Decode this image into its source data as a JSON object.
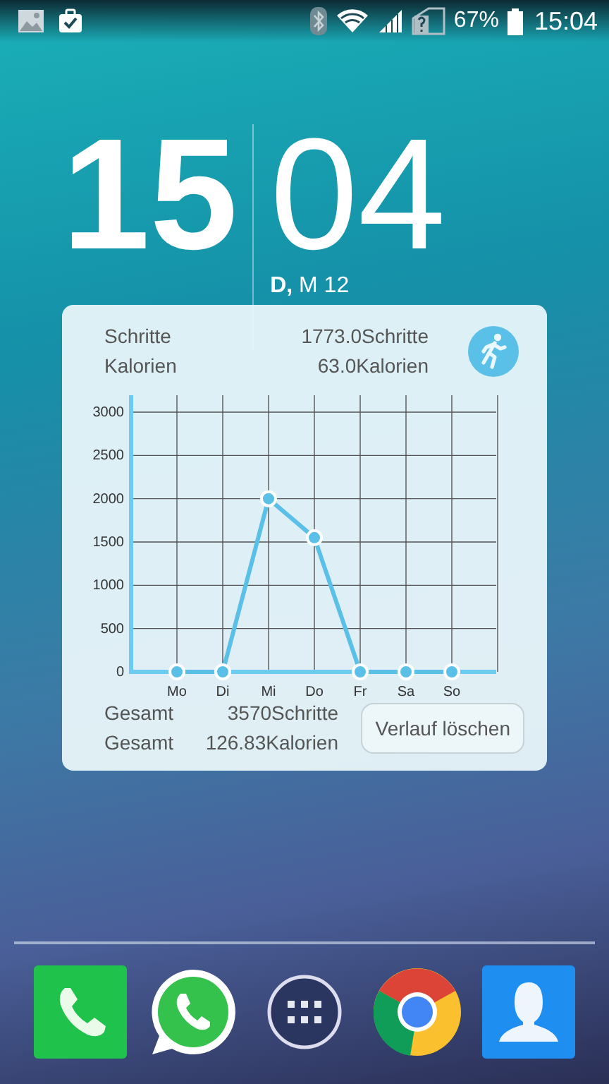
{
  "status_bar": {
    "battery_text": "67%",
    "time": "15:04"
  },
  "clock": {
    "hours": "15",
    "minutes": "04",
    "date": "**D,** M 12"
  },
  "widget": {
    "rows": [
      {
        "label": "Schritte",
        "value": "1773.0Schritte"
      },
      {
        "label": "Kalorien",
        "value": "63.0Kalorien"
      }
    ],
    "chart_data": {
      "type": "line",
      "categories": [
        "Mo",
        "Di",
        "Mi",
        "Do",
        "Fr",
        "Sa",
        "So"
      ],
      "yticks": [
        0,
        500,
        1000,
        1500,
        2000,
        2500,
        3000
      ],
      "ylim": [
        0,
        3000
      ],
      "grid": true,
      "series": [
        {
          "color": "#5bc0e8",
          "marker": "circle",
          "values": [
            0,
            0,
            2000,
            1550,
            0,
            0,
            0
          ]
        }
      ]
    },
    "totals": [
      {
        "label": "Gesamt",
        "value": "3570Schritte"
      },
      {
        "label": "Gesamt",
        "value": "126.83Kalorien"
      }
    ],
    "button": "Verlauf löschen"
  },
  "dock": [
    {
      "kind": "phone"
    },
    {
      "kind": "chat"
    },
    {
      "kind": "apps"
    },
    {
      "kind": "browser"
    },
    {
      "kind": "contacts"
    }
  ]
}
